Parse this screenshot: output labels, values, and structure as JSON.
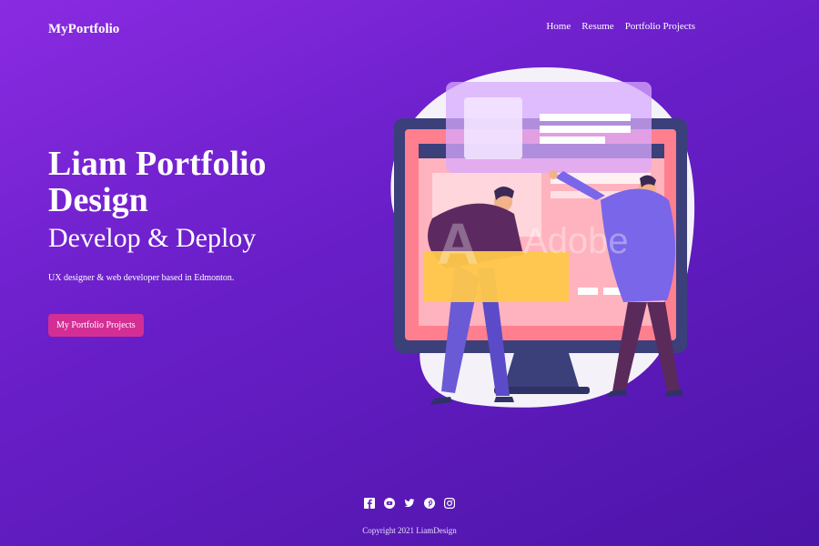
{
  "header": {
    "brand": "MyPortfolio",
    "nav": [
      "Home",
      "Resume",
      "Portfolio Projects"
    ]
  },
  "hero": {
    "title_line1": "Liam Portfolio",
    "title_line2": "Design",
    "subtitle": "Develop & Deploy",
    "description": "UX designer & web developer based in Edmonton.",
    "cta": "My Portfolio Projects"
  },
  "illustration": {
    "watermark": "Adobe"
  },
  "footer": {
    "icons": [
      "facebook-icon",
      "youtube-icon",
      "twitter-icon",
      "pinterest-icon",
      "instagram-icon"
    ],
    "copyright": "Copyright 2021 LiamDesign"
  },
  "colors": {
    "background_start": "#8a2be2",
    "background_end": "#4c14a8",
    "cta": "#d32e94"
  }
}
